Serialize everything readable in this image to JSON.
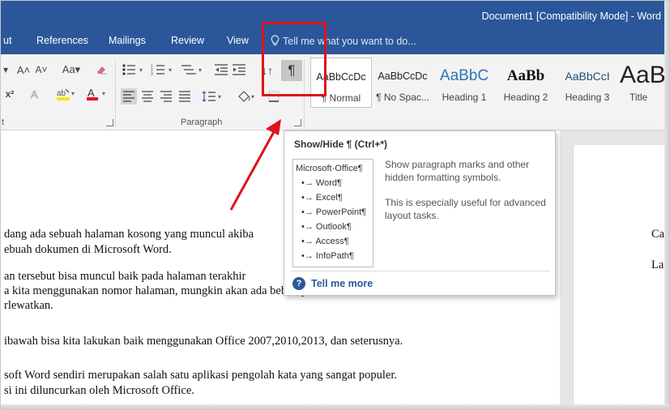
{
  "window": {
    "title": "Document1 [Compatibility Mode] - Word"
  },
  "tabs": [
    {
      "label": "ut"
    },
    {
      "label": "References"
    },
    {
      "label": "Mailings"
    },
    {
      "label": "Review"
    },
    {
      "label": "View"
    }
  ],
  "tell_me": {
    "placeholder": "Tell me what you want to do..."
  },
  "ribbon": {
    "font_row1": {
      "grow": "A˄",
      "shrink": "A˅",
      "change_case": "Aa▾"
    },
    "font_row2": {
      "superscript": "x²"
    },
    "paragraph_label": "Paragraph",
    "font_group_label": "t",
    "show_hide_glyph": "¶",
    "sort_glyph": "↓↑",
    "styles": [
      {
        "sample": "AaBbCcDc",
        "name": "¶ Normal",
        "selected": true
      },
      {
        "sample": "AaBbCcDc",
        "name": "¶ No Spac...",
        "selected": false
      },
      {
        "sample": "AaBbC",
        "name": "Heading 1",
        "selected": false
      },
      {
        "sample": "AaBb",
        "name": "Heading 2",
        "selected": false
      },
      {
        "sample": "AaBbCcI",
        "name": "Heading 3",
        "selected": false
      },
      {
        "sample": "AaB",
        "name": "Title",
        "selected": false
      }
    ]
  },
  "tooltip": {
    "title": "Show/Hide ¶ (Ctrl+*)",
    "preview_heading": "Microsoft·Office¶",
    "preview_items": [
      "Word¶",
      "Excel¶",
      "PowerPoint¶",
      "Outlook¶",
      "Access¶",
      "InfoPath¶"
    ],
    "description_1": "Show paragraph marks and other hidden formatting symbols.",
    "description_2": "This is especially useful for advanced layout tasks.",
    "help_link": "Tell me more"
  },
  "document": {
    "lines": [
      "dang ada sebuah halaman kosong yang muncul akiba",
      "ebuah dokumen di Microsoft Word.",
      "an tersebut bisa muncul baik pada halaman terakhir",
      "a kita menggunakan nomor halaman, mungkin akan ada beberapa halaman tertentu",
      "rlewatkan.",
      "ibawah bisa kita lakukan baik menggunakan Office 2007,2010,2013, dan seterusnya.",
      "soft Word sendiri merupakan salah satu aplikasi pengolah kata yang sangat populer.",
      "si ini diluncurkan oleh Microsoft Office."
    ],
    "page2_lines": [
      "Ca",
      "La"
    ]
  },
  "colors": {
    "word_blue": "#2b579a",
    "annotation_red": "#e0121b"
  }
}
